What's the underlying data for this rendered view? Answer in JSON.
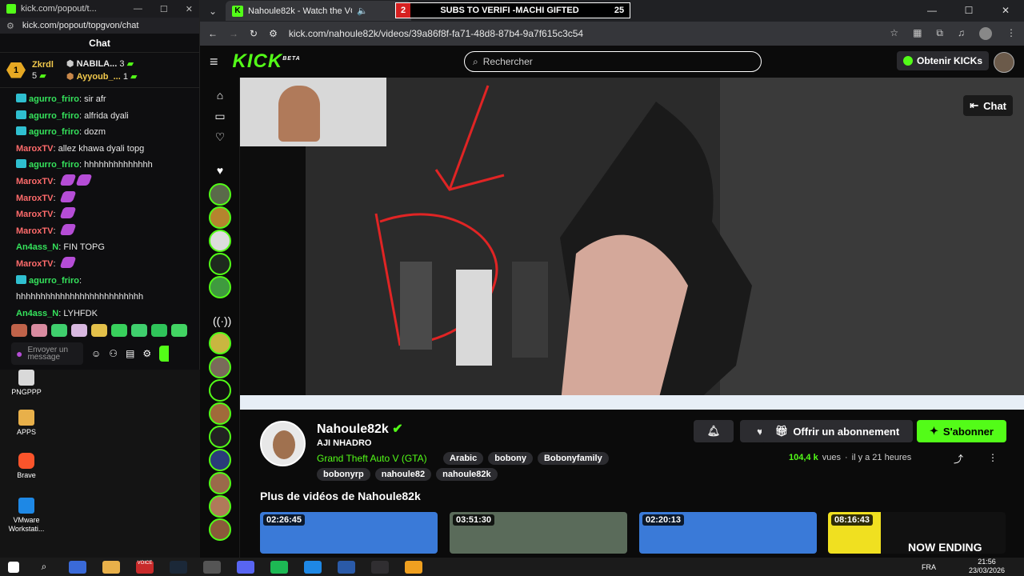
{
  "popout": {
    "title": "kick.com/popout/t...",
    "url": "kick.com/popout/topgvon/chat",
    "chat_header": "Chat",
    "gifters": {
      "first_name": "Zkrdl",
      "first_count": "5",
      "second_name": "NABILA...",
      "second_count": "3",
      "third_name": "Ayyoub_...",
      "third_count": "1"
    },
    "messages": [
      {
        "user": "agurro_friro",
        "sep": ": ",
        "text": "sir afr",
        "badge": true,
        "red": false,
        "emotes": 0
      },
      {
        "user": "agurro_friro",
        "sep": ": ",
        "text": "alfrida dyali",
        "badge": true,
        "red": false,
        "emotes": 0
      },
      {
        "user": "agurro_friro",
        "sep": ": ",
        "text": "dozm",
        "badge": true,
        "red": false,
        "emotes": 0
      },
      {
        "user": "MaroxTV",
        "sep": ": ",
        "text": "allez khawa dyali topg",
        "badge": false,
        "red": true,
        "emotes": 0
      },
      {
        "user": "agurro_friro",
        "sep": ": ",
        "text": "hhhhhhhhhhhhhh",
        "badge": true,
        "red": false,
        "emotes": 0
      },
      {
        "user": "MaroxTV",
        "sep": ": ",
        "text": "",
        "badge": false,
        "red": true,
        "emotes": 2
      },
      {
        "user": "MaroxTV",
        "sep": ": ",
        "text": "",
        "badge": false,
        "red": true,
        "emotes": 1
      },
      {
        "user": "MaroxTV",
        "sep": ": ",
        "text": "",
        "badge": false,
        "red": true,
        "emotes": 1
      },
      {
        "user": "MaroxTV",
        "sep": ": ",
        "text": "",
        "badge": false,
        "red": true,
        "emotes": 1
      },
      {
        "user": "An4ass_N",
        "sep": ": ",
        "text": "FIN TOPG",
        "badge": false,
        "red": false,
        "emotes": 0
      },
      {
        "user": "MaroxTV",
        "sep": ": ",
        "text": "",
        "badge": false,
        "red": true,
        "emotes": 1
      },
      {
        "user": "agurro_friro",
        "sep": ":",
        "text": "",
        "badge": true,
        "red": false,
        "emotes": 0
      },
      {
        "user": "",
        "sep": "",
        "text": "hhhhhhhhhhhhhhhhhhhhhhhhhh",
        "badge": false,
        "red": false,
        "emotes": 0
      },
      {
        "user": "An4ass_N",
        "sep": ": ",
        "text": "LYHFDK",
        "badge": false,
        "red": false,
        "emotes": 0
      }
    ],
    "input_placeholder": "Envoyer un message"
  },
  "desktop_icons": [
    "PNGPPP",
    "APPS",
    "Brave",
    "VMware Workstati..."
  ],
  "browser": {
    "tab_title": "Nahoule82k - Watch the VO",
    "subs_count_left": "2",
    "subs_text": "SUBS TO VERIFI -MACHI GIFTED",
    "subs_count_right": "25",
    "url": "kick.com/nahoule82k/videos/39a86f8f-fa71-48d8-87b4-9a7f615c3c54"
  },
  "kick": {
    "logo": "KICK",
    "logo_beta": "BETA",
    "search_placeholder": "Rechercher",
    "get_kicks": "Obtenir KICKs",
    "chat_button": "Chat",
    "channel": {
      "name": "Nahoule82k",
      "title": "AJI NHADRO",
      "category": "Grand Theft Auto V (GTA)",
      "tags": [
        "Arabic",
        "bobony",
        "Bobonyfamily",
        "bobonyrp",
        "nahoule82",
        "nahoule82k"
      ],
      "views_count": "104,4 k",
      "views_label": "vues",
      "ago": "il y a 21 heures",
      "gift_sub": "Offrir un abonnement",
      "subscribe": "S'abonner"
    },
    "more_videos_title": "Plus de vidéos de Nahoule82k",
    "videos": [
      {
        "duration": "02:26:45"
      },
      {
        "duration": "03:51:30"
      },
      {
        "duration": "02:20:13"
      },
      {
        "duration": "08:16:43",
        "caption": "NOW ENDING"
      }
    ]
  },
  "taskbar": {
    "lang": "FRA",
    "time": "21:56",
    "date": "23/03/2026",
    "voice_label": "VOICE"
  },
  "colors": {
    "kick_green": "#53fc18",
    "chat_user_green": "#35e35c",
    "sub_red": "#d62020"
  }
}
